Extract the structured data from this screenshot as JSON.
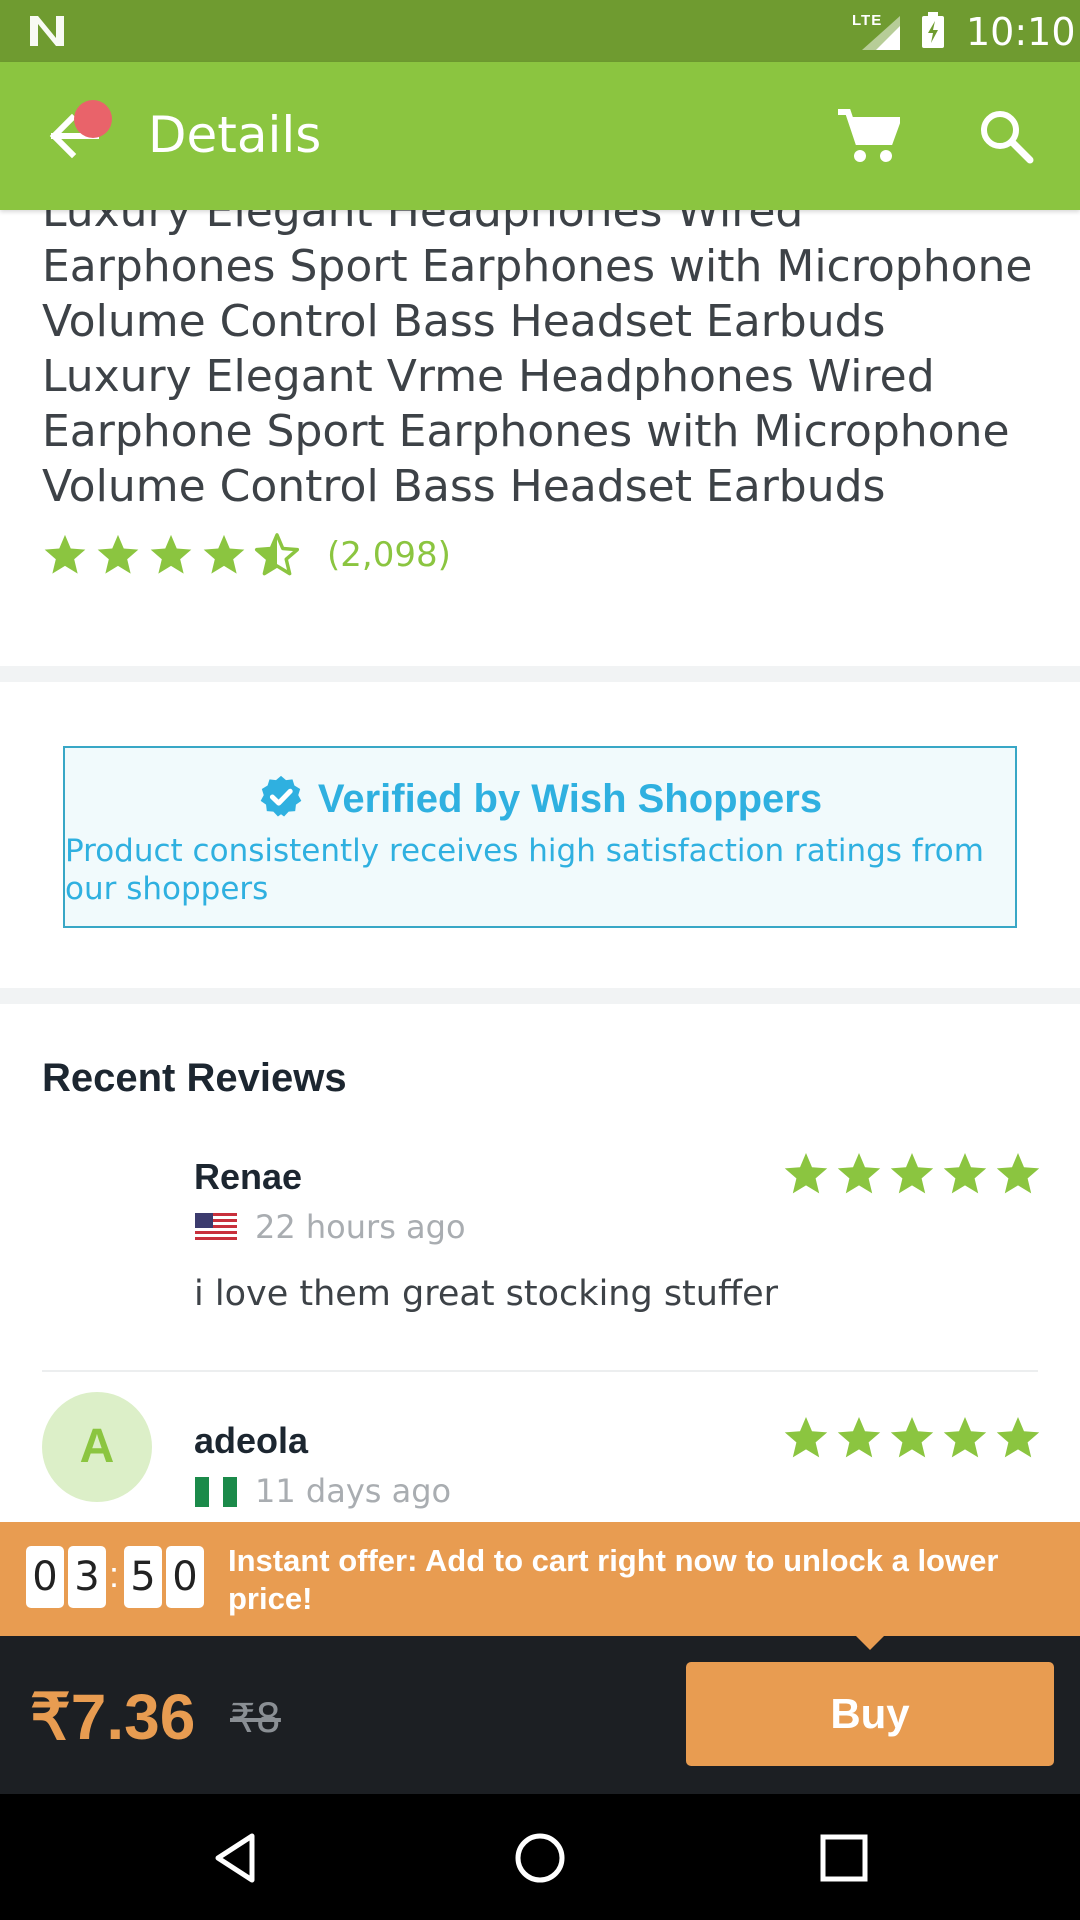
{
  "status_bar": {
    "network": "LTE",
    "time": "10:10",
    "icons": [
      "notification-n-icon",
      "signal-icon",
      "battery-charging-icon"
    ]
  },
  "app_bar": {
    "title": "Details",
    "icons": [
      "back-arrow-icon",
      "cart-icon",
      "search-icon"
    ],
    "background": "#8bc540",
    "badge_color": "#e9636a"
  },
  "product": {
    "description": "Luxury Elegant Headphones Wired Earphones Sport Earphones with Microphone Volume Control Bass Headset Earbuds Luxury Elegant Vrme Headphones Wired Earphone Sport Earphones with Microphone Volume Control Bass Headset Earbuds",
    "rating_stars": 4.5,
    "rating_count": "(2,098)"
  },
  "verified": {
    "title": "Verified by Wish Shoppers",
    "subtitle": "Product consistently receives high satisfaction ratings from our shoppers",
    "color": "#2fb0e0"
  },
  "reviews": {
    "title": "Recent Reviews",
    "items": [
      {
        "name": "Renae",
        "country": "United States",
        "time": "22 hours ago",
        "text": "i love them great stocking stuffer",
        "stars": 5
      },
      {
        "name": "adeola",
        "country": "Nigeria",
        "avatar_letter": "A",
        "time": "11 days ago",
        "stars": 5
      }
    ]
  },
  "offer": {
    "timer": [
      "0",
      "3",
      "5",
      "0"
    ],
    "timer_separator": ":",
    "message": "Instant offer: Add to cart right now to unlock a lower price!",
    "color": "#e89c51"
  },
  "purchase": {
    "price": "₹7.36",
    "original_price": "₹8",
    "buy_label": "Buy"
  },
  "nav_bar": {
    "icons": [
      "nav-back-icon",
      "nav-home-icon",
      "nav-recents-icon"
    ]
  }
}
